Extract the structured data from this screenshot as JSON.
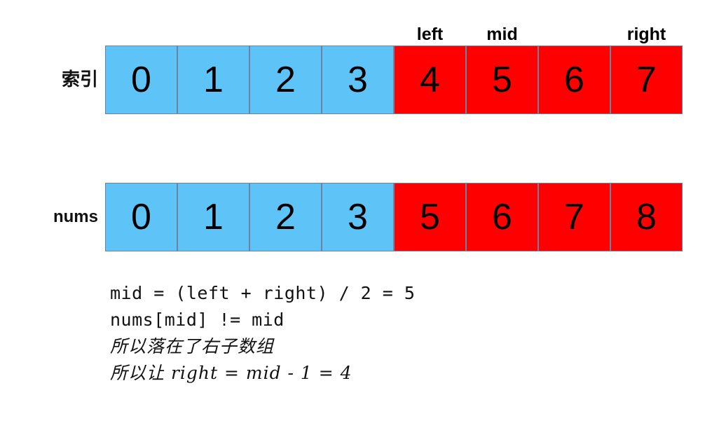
{
  "diagram": {
    "title": "binary-search-step-illustration",
    "colors": {
      "blue_cell": "#5ec3f7",
      "red_cell": "#fe0000",
      "cell_border": "#6b84a3",
      "text": "#111111"
    },
    "pointer_labels": [
      "",
      "",
      "",
      "",
      "left",
      "mid",
      "",
      "right"
    ],
    "rows": [
      {
        "label": "索引",
        "label_lang": "cjk",
        "cells": [
          {
            "value": "0",
            "color": "blue"
          },
          {
            "value": "1",
            "color": "blue"
          },
          {
            "value": "2",
            "color": "blue"
          },
          {
            "value": "3",
            "color": "blue"
          },
          {
            "value": "4",
            "color": "red"
          },
          {
            "value": "5",
            "color": "red"
          },
          {
            "value": "6",
            "color": "red"
          },
          {
            "value": "7",
            "color": "red"
          }
        ]
      },
      {
        "label": "nums",
        "label_lang": "latin",
        "cells": [
          {
            "value": "0",
            "color": "blue"
          },
          {
            "value": "1",
            "color": "blue"
          },
          {
            "value": "2",
            "color": "blue"
          },
          {
            "value": "3",
            "color": "blue"
          },
          {
            "value": "5",
            "color": "red"
          },
          {
            "value": "6",
            "color": "red"
          },
          {
            "value": "7",
            "color": "red"
          },
          {
            "value": "8",
            "color": "red"
          }
        ]
      }
    ],
    "explanation": [
      {
        "text": "mid = (left + right) / 2 = 5",
        "lang": "mono"
      },
      {
        "text": "nums[mid] != mid",
        "lang": "mono"
      },
      {
        "text": "所以落在了右子数组",
        "lang": "cjk"
      },
      {
        "text": "所以让 right = mid - 1 = 4",
        "lang": "cjk-mixed"
      }
    ]
  }
}
